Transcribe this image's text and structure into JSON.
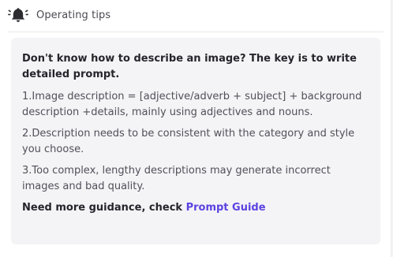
{
  "header": {
    "icon": "bell-icon",
    "title": "Operating tips"
  },
  "tips": {
    "lead": "Don't know how to describe an image? The key is to write detailed prompt.",
    "items": [
      "1.Image description = [adjective/adverb + subject] + background description +details, mainly using adjectives and nouns.",
      "2.Description needs to be consistent with the category and style you choose.",
      "3.Too complex, lengthy descriptions may generate incorrect images and bad quality."
    ],
    "more_text": "Need more guidance, check ",
    "link_label": "Prompt Guide"
  },
  "colors": {
    "accent": "#5b43e0",
    "card_bg": "#f4f4f7",
    "icon": "#2b2b30"
  }
}
